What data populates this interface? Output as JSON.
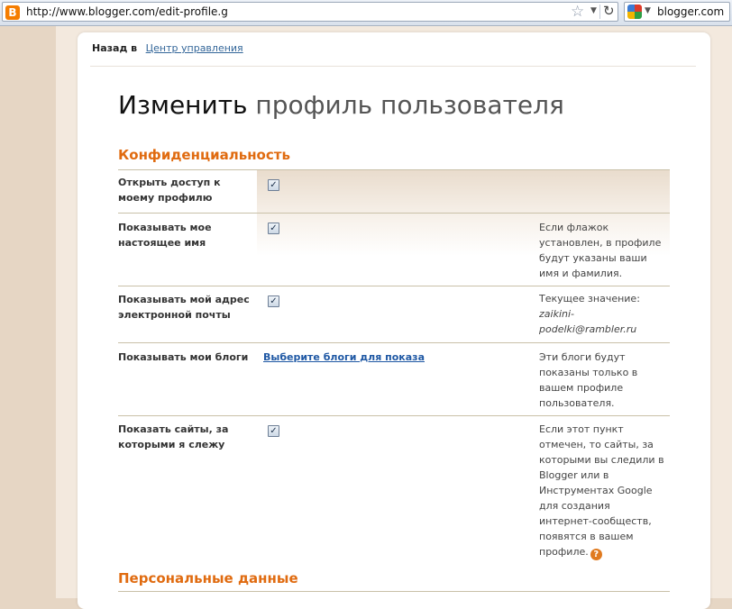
{
  "browser": {
    "url": "http://www.blogger.com/edit-profile.g",
    "search_engine_label": "blogger.com",
    "site_icon_glyph": "B",
    "icons": {
      "site": "blogger-icon",
      "bookmark": "star-icon",
      "reload": "reload-icon",
      "search_engine": "google-icon"
    }
  },
  "nav": {
    "back_label": "Назад в",
    "back_link": "Центр управления"
  },
  "page": {
    "title_main": "Изменить",
    "title_sub": "профиль пользователя"
  },
  "sections": {
    "privacy_heading": "Конфиденциальность",
    "personal_heading": "Персональные данные"
  },
  "settings": [
    {
      "label": "Открыть доступ к моему профилю",
      "control": "checkbox",
      "checked": true,
      "help": ""
    },
    {
      "label": "Показывать мое настоящее имя",
      "control": "checkbox",
      "checked": true,
      "help": "Если флажок установлен, в профиле будут указаны ваши имя и фамилия."
    },
    {
      "label": "Показывать мой адрес электронной почты",
      "control": "checkbox",
      "checked": true,
      "help": "Текущее значение:",
      "help_email": "zaikini-podelki@rambler.ru"
    },
    {
      "label": "Показывать мои блоги",
      "control": "link",
      "link_text": "Выберите блоги для показа",
      "help": "Эти блоги будут показаны только в вашем профиле пользователя."
    },
    {
      "label": "Показать сайты, за которыми я слежу",
      "control": "checkbox",
      "checked": true,
      "help": "Если этот пункт отмечен, то сайты, за которыми вы следили в Blogger или в Инструментах Google для создания интернет-сообществ, появятся в вашем профиле.",
      "help_icon": "?"
    }
  ],
  "colors": {
    "accent": "#e06b10",
    "link": "#336699",
    "frame": "#e6d6c4"
  }
}
